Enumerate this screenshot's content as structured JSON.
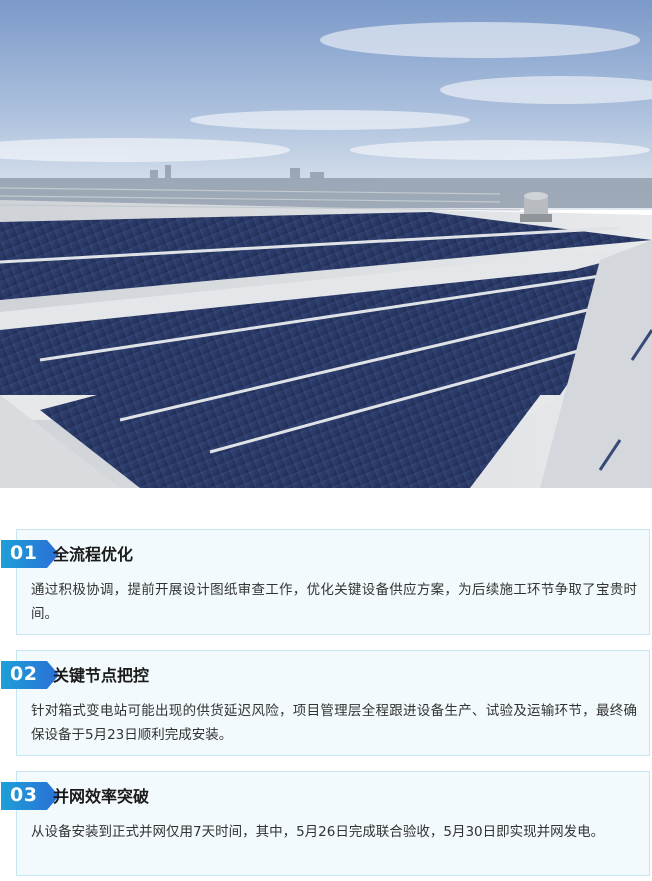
{
  "hero_image": {
    "description_icon": "solar-panel-rooftop-photo",
    "colors": {
      "sky_top": "#7d9ccc",
      "sky_bottom": "#dbe4ef",
      "panel": "#2d3d6b",
      "roof": "#d8dce0"
    }
  },
  "sections": [
    {
      "number": "01",
      "title": "全流程优化",
      "body": "通过积极协调，提前开展设计图纸审查工作，优化关键设备供应方案，为后续施工环节争取了宝贵时间。"
    },
    {
      "number": "02",
      "title": "关键节点把控",
      "body": "针对箱式变电站可能出现的供货延迟风险，项目管理层全程跟进设备生产、试验及运输环节，最终确保设备于5月23日顺利完成安装。"
    },
    {
      "number": "03",
      "title": "并网效率突破",
      "body": "从设备安装到正式并网仅用7天时间，其中，5月26日完成联合验收，5月30日即实现并网发电。"
    }
  ],
  "colors": {
    "badge_gradient_start": "#1ea0d8",
    "badge_gradient_end": "#2a6fd6",
    "card_border": "#c8e6f2",
    "card_bg": "#f3fafd"
  }
}
